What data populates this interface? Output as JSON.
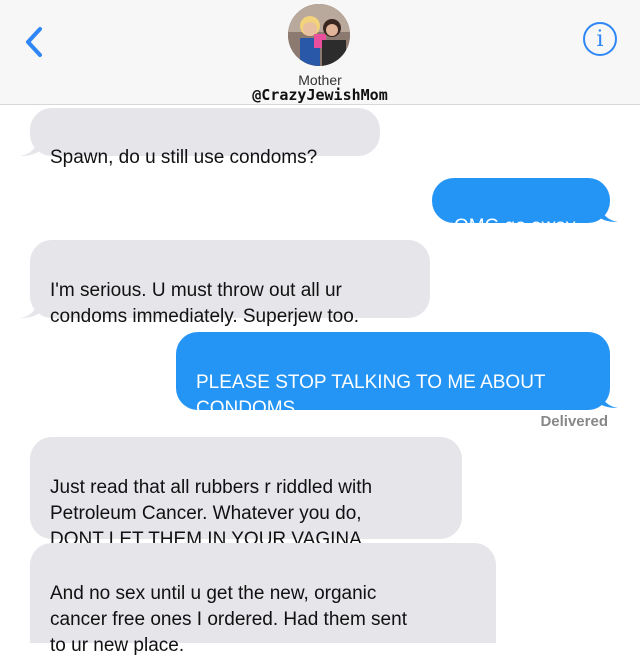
{
  "header": {
    "contact_name": "Mother",
    "handle": "@CrazyJewishMom",
    "back_icon": "chevron-left-icon",
    "info_icon": "info-icon",
    "info_glyph": "i",
    "accent_color": "#2f86f6"
  },
  "messages": [
    {
      "direction": "incoming",
      "text": "Spawn, do u still use condoms?"
    },
    {
      "direction": "outgoing",
      "text": "OMG go away"
    },
    {
      "direction": "incoming",
      "text": "I'm serious. U must throw  out all ur\ncondoms immediately. Superjew too."
    },
    {
      "direction": "outgoing",
      "text": "PLEASE STOP TALKING TO ME ABOUT\nCONDOMS"
    },
    {
      "direction": "incoming",
      "text": "Just read that all rubbers r riddled with\nPetroleum Cancer. Whatever you do,\nDONT LET THEM IN YOUR VAGINA"
    },
    {
      "direction": "incoming",
      "text": "And no sex until u get the new, organic\ncancer free ones I ordered. Had them sent\nto ur new place."
    }
  ],
  "status": {
    "delivered": "Delivered"
  },
  "colors": {
    "incoming_bubble": "#e5e5ea",
    "outgoing_bubble": "#2495f5"
  }
}
